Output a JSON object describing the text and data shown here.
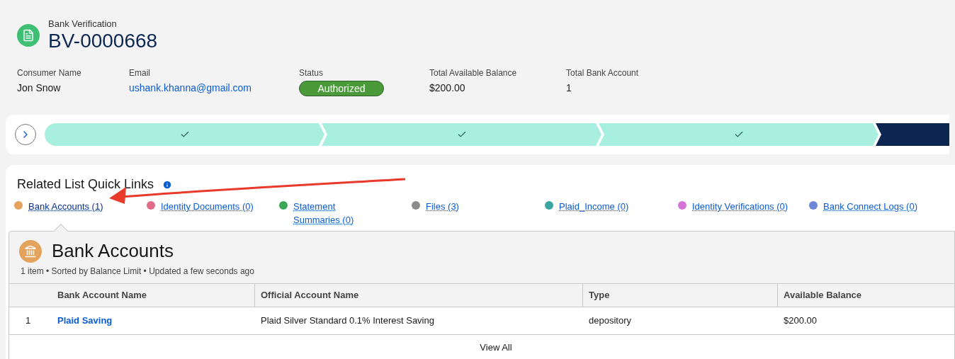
{
  "record": {
    "object_label": "Bank Verification",
    "title": "BV-0000668"
  },
  "fields": [
    {
      "label": "Consumer Name",
      "value": "Jon Snow",
      "kind": "text"
    },
    {
      "label": "Email",
      "value": "ushank.khanna@gmail.com",
      "kind": "link"
    },
    {
      "label": "Status",
      "value": "Authorized",
      "kind": "badge"
    },
    {
      "label": "Total Available Balance",
      "value": "$200.00",
      "kind": "text"
    },
    {
      "label": "Total Bank Account",
      "value": "1",
      "kind": "text"
    }
  ],
  "path": {
    "stages": [
      {
        "completed": true
      },
      {
        "completed": true
      },
      {
        "completed": true
      },
      {
        "completed": false
      }
    ]
  },
  "quick_links": {
    "title": "Related List Quick Links",
    "links": [
      {
        "label": "Bank Accounts (1)",
        "color": "#e3a35c",
        "selected": true
      },
      {
        "label": "Identity Documents (0)",
        "color": "#e06c8a",
        "selected": false
      },
      {
        "label": "Statement Summaries (0)",
        "color": "#3ba755",
        "selected": false
      },
      {
        "label": "Files (3)",
        "color": "#8c8c8c",
        "selected": false
      },
      {
        "label": "Plaid_Income (0)",
        "color": "#3aa6a0",
        "selected": false
      },
      {
        "label": "Identity Verifications (0)",
        "color": "#d574d8",
        "selected": false
      },
      {
        "label": "Bank Connect Logs (0)",
        "color": "#6d88d6",
        "selected": false
      }
    ]
  },
  "related_list": {
    "title": "Bank Accounts",
    "summary": "1 item • Sorted by Balance Limit • Updated a few seconds ago",
    "columns": [
      "Bank Account Name",
      "Official Account Name",
      "Type",
      "Available Balance"
    ],
    "rows": [
      {
        "number": "1",
        "cells": [
          "Plaid Saving",
          "Plaid Silver Standard 0.1% Interest Saving",
          "depository",
          "$200.00"
        ]
      }
    ],
    "footer_link": "View All"
  }
}
